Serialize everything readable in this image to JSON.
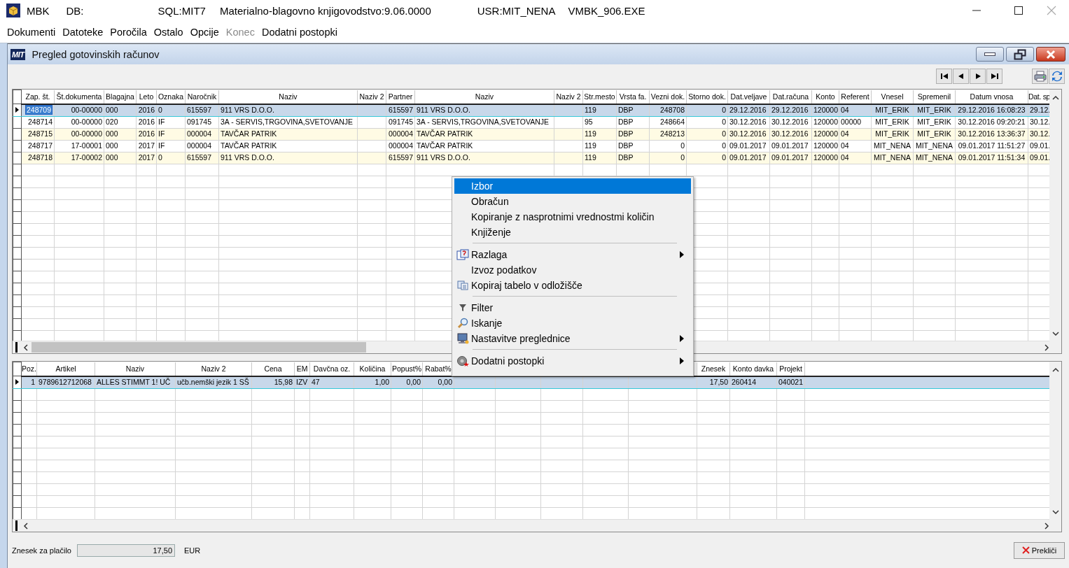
{
  "app_window": {
    "title_parts": [
      "MBK",
      "DB:",
      "SQL:MIT7",
      "Materialno-blagovno knjigovodstvo:9.06.0000",
      "USR:MIT_NENA",
      "VMBK_906.EXE"
    ]
  },
  "menu": [
    {
      "label": "Dokumenti",
      "disabled": false
    },
    {
      "label": "Datoteke",
      "disabled": false
    },
    {
      "label": "Poročila",
      "disabled": false
    },
    {
      "label": "Ostalo",
      "disabled": false
    },
    {
      "label": "Opcije",
      "disabled": false
    },
    {
      "label": "Konec",
      "disabled": true
    },
    {
      "label": "Dodatni postopki",
      "disabled": false
    }
  ],
  "document_window": {
    "logo": "MIT",
    "title": "Pregled gotovinskih računov"
  },
  "receipts_table": {
    "columns": [
      "Zap. št.",
      "Št.dokumenta",
      "Blagajna",
      "Leto",
      "Oznaka",
      "Naročnik",
      "Naziv",
      "Naziv 2",
      "Partner",
      "Naziv",
      "Naziv 2",
      "Str.mesto",
      "Vrsta fa.",
      "Vezni dok.",
      "Storno dok.",
      "Dat.veljave",
      "Dat.računa",
      "Konto",
      "Referent",
      "Vnesel",
      "Spremenil",
      "Datum vnosa",
      "Dat. sp"
    ],
    "rows": [
      {
        "selected": true,
        "cells": [
          "248709",
          "00-00000",
          "000",
          "2016",
          "0",
          "615597",
          "911 VRS D.O.O.",
          "",
          "615597",
          "911 VRS D.O.O.",
          "",
          "119",
          "DBP",
          "248708",
          "0",
          "29.12.2016",
          "29.12.2016",
          "120000",
          "04",
          "MIT_ERIK",
          "MIT_ERIK",
          "29.12.2016 16:08:23",
          "29.12."
        ]
      },
      {
        "selected": false,
        "cells": [
          "248714",
          "00-00000",
          "020",
          "2016",
          "IF",
          "091745",
          "3A - SERVIS,TRGOVINA,SVETOVANJE",
          "",
          "091745",
          "3A - SERVIS,TRGOVINA,SVETOVANJE",
          "",
          "95",
          "DBP",
          "248664",
          "0",
          "30.12.2016",
          "30.12.2016",
          "120000",
          "00000",
          "MIT_ERIK",
          "MIT_ERIK",
          "30.12.2016 09:20:21",
          "30.12."
        ]
      },
      {
        "selected": false,
        "cells": [
          "248715",
          "00-00000",
          "000",
          "2016",
          "IF",
          "000004",
          "TAVČAR PATRIK",
          "",
          "000004",
          "TAVČAR PATRIK",
          "",
          "119",
          "DBP",
          "248213",
          "0",
          "30.12.2016",
          "30.12.2016",
          "120000",
          "04",
          "MIT_ERIK",
          "MIT_ERIK",
          "30.12.2016 13:36:37",
          "30.12."
        ]
      },
      {
        "selected": false,
        "cells": [
          "248717",
          "17-00001",
          "000",
          "2017",
          "IF",
          "000004",
          "TAVČAR PATRIK",
          "",
          "000004",
          "TAVČAR PATRIK",
          "",
          "119",
          "DBP",
          "0",
          "0",
          "09.01.2017",
          "09.01.2017",
          "120000",
          "04",
          "MIT_NENA",
          "MIT_NENA",
          "09.01.2017 11:51:27",
          "09.01."
        ]
      },
      {
        "selected": false,
        "cells": [
          "248718",
          "17-00002",
          "000",
          "2017",
          "0",
          "615597",
          "911 VRS D.O.O.",
          "",
          "615597",
          "911 VRS D.O.O.",
          "",
          "119",
          "DBP",
          "0",
          "0",
          "09.01.2017",
          "09.01.2017",
          "120000",
          "04",
          "MIT_NENA",
          "MIT_NENA",
          "09.01.2017 11:51:34",
          "09.01."
        ]
      }
    ]
  },
  "items_table": {
    "columns": [
      "Poz.",
      "Artikel",
      "Naziv",
      "Naziv 2",
      "Cena",
      "EM",
      "Davčna oz.",
      "Količina",
      "Popust%",
      "Rabat%",
      "Znesek",
      "Konto davka",
      "Projekt"
    ],
    "rows": [
      {
        "selected": true,
        "cells": [
          "1",
          "9789612712068",
          "ALLES STIMMT 1! UČ",
          "učb.nemški jezik  1 SŠ",
          "15,98",
          "IZV",
          "47",
          "1,00",
          "0,00",
          "0,00",
          "17,50",
          "260414",
          "040021"
        ]
      }
    ]
  },
  "context_menu": [
    {
      "kind": "item",
      "label": "Izbor",
      "selected": true,
      "submenu": false
    },
    {
      "kind": "item",
      "label": "Obračun",
      "selected": false,
      "submenu": false
    },
    {
      "kind": "item",
      "label": "Kopiranje z nasprotnimi vrednostmi količin",
      "selected": false,
      "submenu": false
    },
    {
      "kind": "item",
      "label": "Knjiženje",
      "selected": false,
      "submenu": false
    },
    {
      "kind": "separator"
    },
    {
      "kind": "item",
      "label": "Razlaga",
      "selected": false,
      "submenu": true
    },
    {
      "kind": "item",
      "label": "Izvoz podatkov",
      "selected": false,
      "submenu": false
    },
    {
      "kind": "item",
      "label": "Kopiraj tabelo v odložišče",
      "selected": false,
      "submenu": false
    },
    {
      "kind": "separator"
    },
    {
      "kind": "item",
      "label": "Filter",
      "selected": false,
      "submenu": false
    },
    {
      "kind": "item",
      "label": "Iskanje",
      "selected": false,
      "submenu": false
    },
    {
      "kind": "item",
      "label": "Nastavitve preglednice",
      "selected": false,
      "submenu": true
    },
    {
      "kind": "separator"
    },
    {
      "kind": "item",
      "label": "Dodatni postopki",
      "selected": false,
      "submenu": true
    }
  ],
  "footer": {
    "label": "Znesek za plačilo",
    "value": "17,50",
    "currency": "EUR",
    "cancel_button": "Prekliči"
  }
}
